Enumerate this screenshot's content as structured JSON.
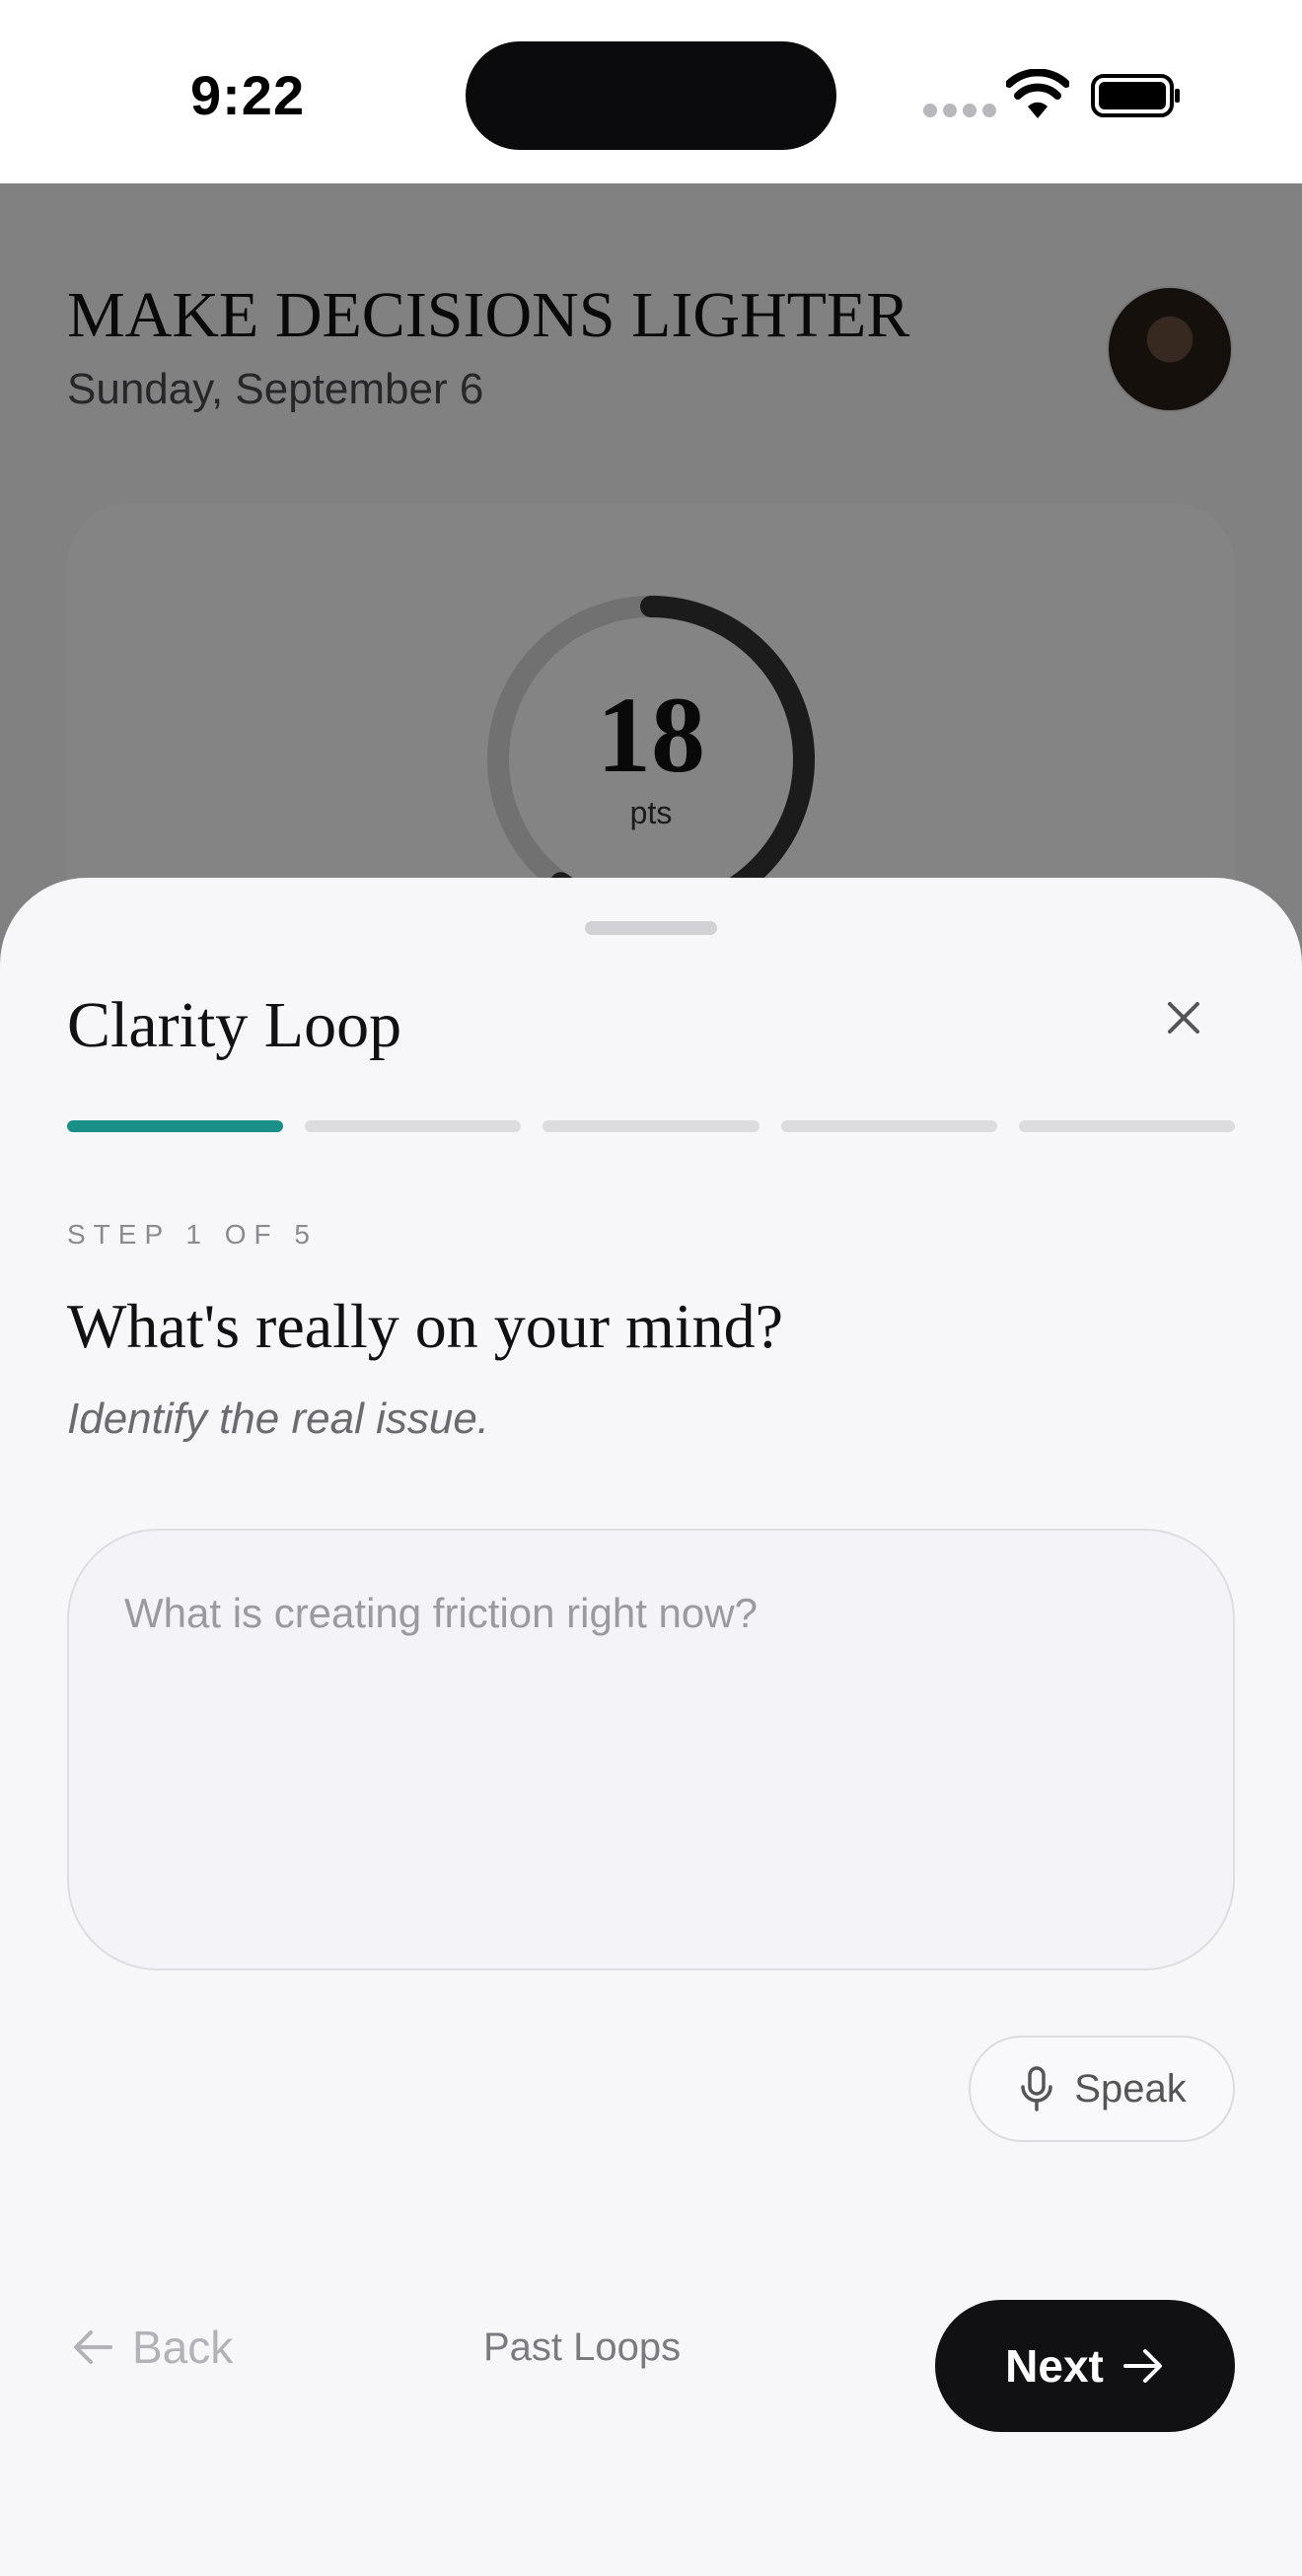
{
  "status_bar": {
    "time": "9:22"
  },
  "background": {
    "title": "MAKE DECISIONS LIGHTER",
    "date": "Sunday, September 6",
    "score": {
      "value": "18",
      "unit": "pts",
      "ring_fraction": 0.6
    }
  },
  "sheet": {
    "title": "Clarity Loop",
    "progress": {
      "current_step": 1,
      "total_steps": 5
    },
    "step_label": "STEP 1 OF 5",
    "question": "What's really on your mind?",
    "hint": "Identify the real issue.",
    "answer": {
      "value": "",
      "placeholder": "What is creating friction right now?"
    },
    "speak_label": "Speak",
    "footer": {
      "back_label": "Back",
      "past_loops_label": "Past Loops",
      "next_label": "Next"
    }
  },
  "colors": {
    "accent": "#1a8f88",
    "primary_button": "#111113",
    "scrim": "rgba(0,0,0,0.47)"
  },
  "icons": [
    "wifi-icon",
    "battery-icon",
    "close-icon",
    "microphone-icon",
    "arrow-left-icon",
    "arrow-right-icon"
  ]
}
